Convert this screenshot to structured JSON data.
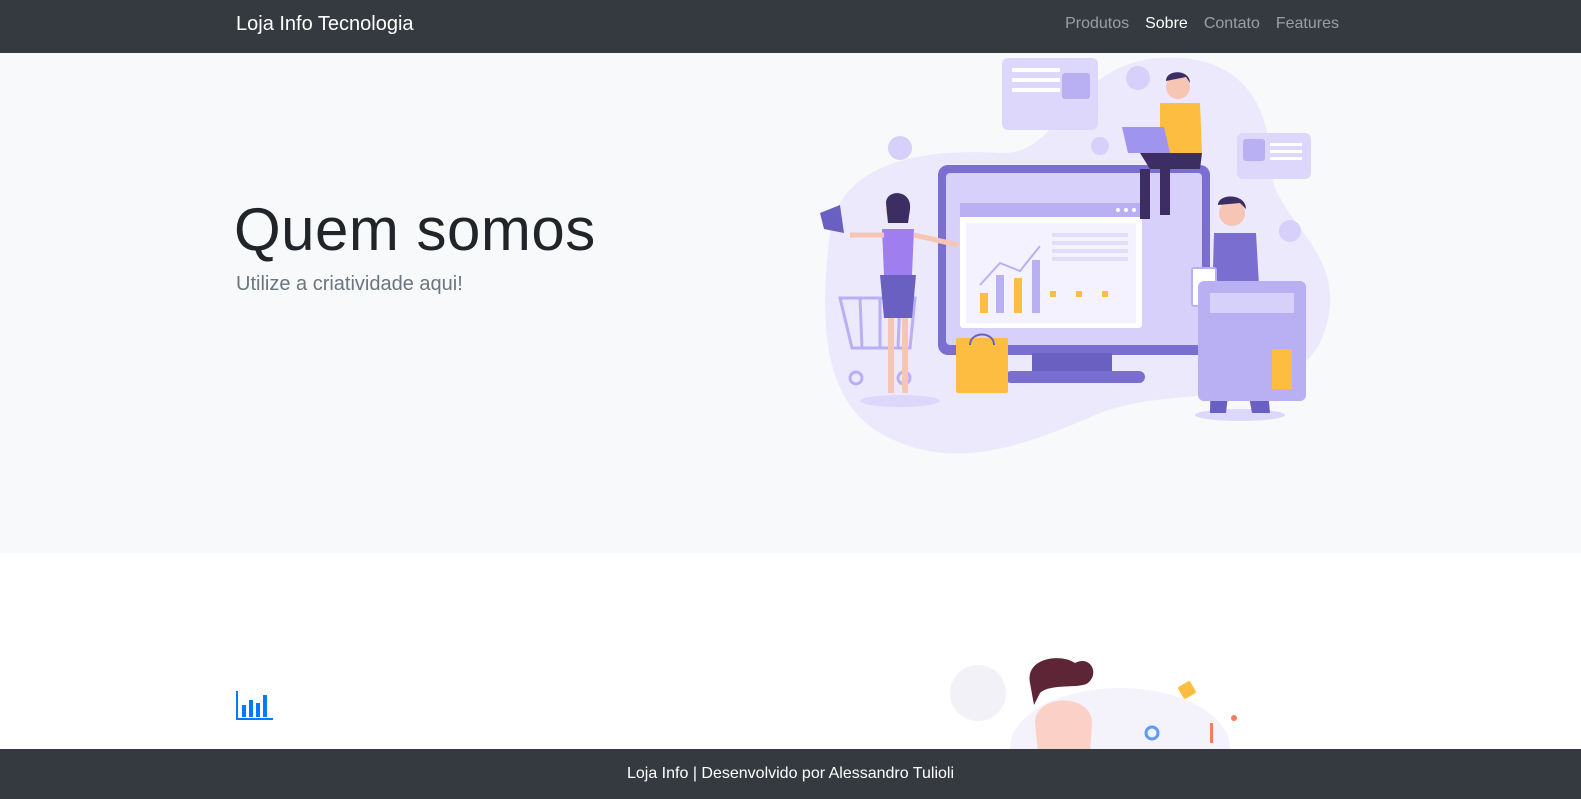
{
  "navbar": {
    "brand": "Loja Info Tecnologia",
    "links": [
      {
        "label": "Produtos"
      },
      {
        "label": "Sobre"
      },
      {
        "label": "Contato"
      },
      {
        "label": "Features"
      }
    ]
  },
  "hero": {
    "title": "Quem somos",
    "subtitle": "Utilize a criatividade aqui!"
  },
  "section": {
    "icon": "bar-chart-icon"
  },
  "footer": {
    "text": "Loja Info | Desenvolvido por Alessandro Tulioli"
  },
  "colors": {
    "navbar_bg": "#343a40",
    "hero_bg": "#f8f9fa",
    "accent_blue": "#007bff",
    "illustration_purple": "#7a6fd1",
    "illustration_yellow": "#fdbd40"
  }
}
